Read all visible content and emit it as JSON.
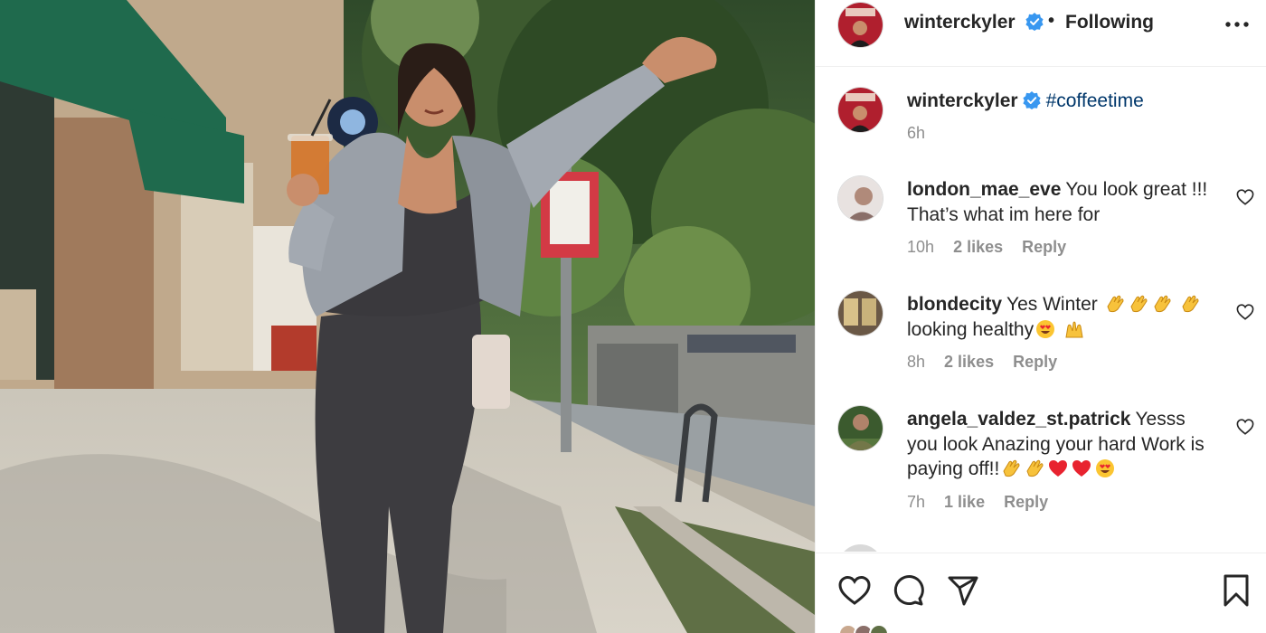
{
  "post": {
    "author": "winterckyler",
    "verified": true,
    "follow_status": "Following",
    "caption": "#coffeetime",
    "time": "6h"
  },
  "comments": [
    {
      "user": "london_mae_eve",
      "text": "You look great !!! That’s what im here for",
      "time": "10h",
      "likes": "2 likes",
      "reply": "Reply"
    },
    {
      "user": "blondecity",
      "text_a": "Yes Winter",
      "text_b": "looking healthy",
      "emoji_a": [
        "clapping-hands",
        "clapping-hands",
        "clapping-hands",
        "clapping-hands"
      ],
      "emoji_b": [
        "heart-eyes",
        "raising-hands"
      ],
      "time": "8h",
      "likes": "2 likes",
      "reply": "Reply"
    },
    {
      "user": "angela_valdez_st.patrick",
      "text": "Yesss you look Anazing your hard Work is paying off!!",
      "emoji": [
        "clapping-hands",
        "clapping-hands",
        "red-heart",
        "red-heart",
        "heart-eyes"
      ],
      "time": "7h",
      "likes": "1 like",
      "reply": "Reply"
    }
  ],
  "icons": {
    "verified": "verified-badge-icon",
    "more": "more-options-icon",
    "like": "heart-icon",
    "comment": "comment-bubble-icon",
    "share": "paper-plane-icon",
    "save": "bookmark-icon"
  },
  "colors": {
    "verified_blue": "#3897f0",
    "hashtag": "#00376b",
    "muted": "#8e8e8e",
    "text": "#262626"
  }
}
